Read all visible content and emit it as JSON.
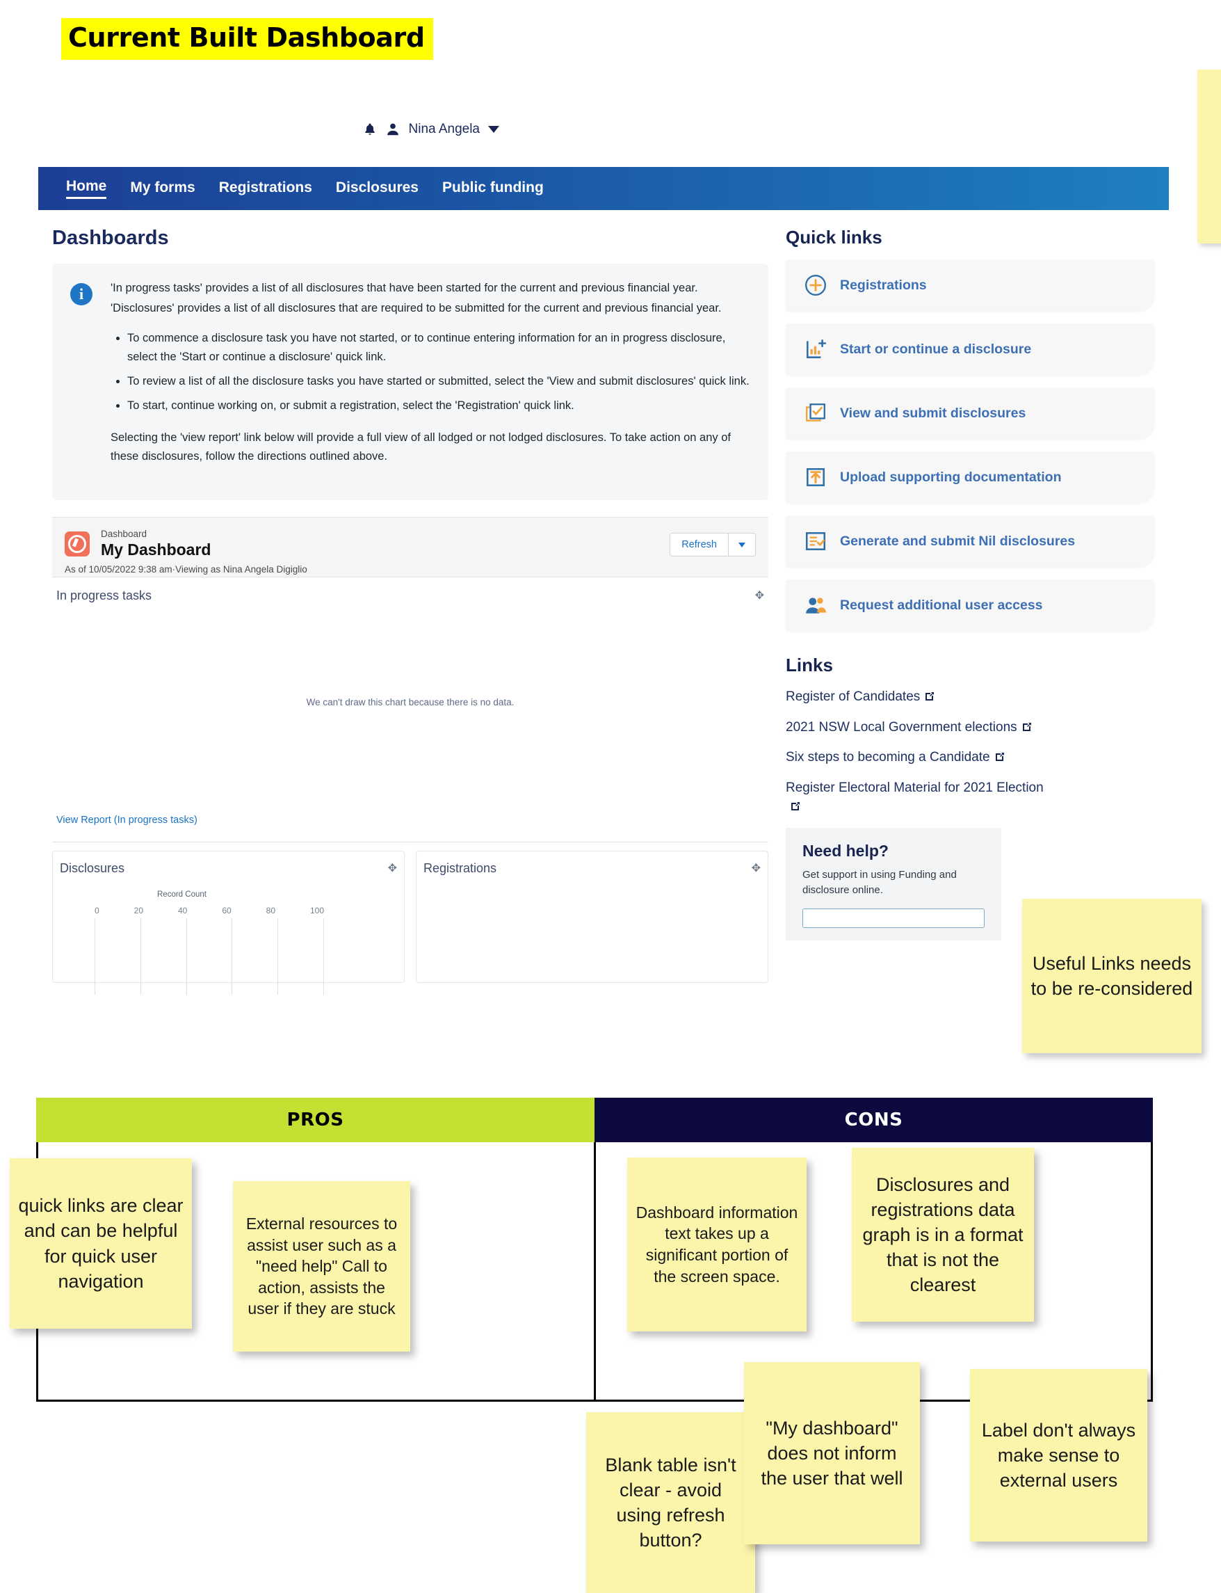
{
  "slide": {
    "title": "Current Built Dashboard"
  },
  "topbar": {
    "bell_icon": "bell-icon",
    "person_icon": "person-icon",
    "username": "Nina Angela",
    "caret_icon": "chevron-down-icon"
  },
  "nav": {
    "items": [
      {
        "label": "Home",
        "active": true
      },
      {
        "label": "My forms",
        "active": false
      },
      {
        "label": "Registrations",
        "active": false
      },
      {
        "label": "Disclosures",
        "active": false
      },
      {
        "label": "Public funding",
        "active": false
      }
    ]
  },
  "main": {
    "heading": "Dashboards",
    "info": {
      "icon": "info-icon",
      "para1": "'In progress tasks' provides a list of all disclosures that have been started for the current and previous financial year.",
      "para2": "'Disclosures' provides a list of all disclosures that are required to be submitted for the current and previous financial year.",
      "bullets": [
        "To commence a disclosure task you have not started, or to continue entering information for an in progress disclosure, select the 'Start or continue a disclosure' quick link.",
        "To review a list of all the disclosure tasks you have started or submitted, select the 'View and submit disclosures' quick link.",
        "To start, continue working on, or submit a registration, select the 'Registration' quick link."
      ],
      "tail": "Selecting the 'view report' link below will provide a full view of all lodged or not lodged disclosures. To take action on any of these disclosures, follow the directions outlined above."
    },
    "dashboard_card": {
      "logo_icon": "salesforce-dashboard-icon",
      "kind": "Dashboard",
      "name": "My Dashboard",
      "as_of": "As of 10/05/2022 9:38 am·Viewing as Nina Angela Digiglio",
      "refresh_label": "Refresh",
      "refresh_caret_icon": "chevron-down-icon"
    },
    "in_progress": {
      "title": "In progress tasks",
      "expand_icon": "expand-icon",
      "no_data": "We can't draw this chart because there is no data.",
      "view_report": "View Report (In progress tasks)"
    }
  },
  "chart_data": [
    {
      "type": "bar",
      "title": "Disclosures",
      "xlabel": "Record Count",
      "ylabel": "",
      "categories": [],
      "values": [],
      "xticks": [
        "0",
        "20",
        "40",
        "60",
        "80",
        "100"
      ],
      "xlim": [
        0,
        100
      ],
      "grid": true,
      "legend": "none",
      "expand_icon": "expand-icon",
      "note": "empty chart - axis only, no bars rendered"
    },
    {
      "type": "bar",
      "title": "Registrations",
      "xlabel": "",
      "ylabel": "",
      "categories": [],
      "values": [],
      "xticks": [],
      "grid": false,
      "legend": "none",
      "expand_icon": "expand-icon",
      "note": "empty chart - no data rendered"
    }
  ],
  "quick_links": {
    "heading": "Quick links",
    "items": [
      {
        "label": "Registrations",
        "icon": "plus-circle-icon"
      },
      {
        "label": "Start or continue a disclosure",
        "icon": "chart-add-icon"
      },
      {
        "label": "View and submit disclosures",
        "icon": "checked-box-icon"
      },
      {
        "label": "Upload supporting documentation",
        "icon": "upload-box-icon"
      },
      {
        "label": "Generate and submit Nil disclosures",
        "icon": "checklist-icon"
      },
      {
        "label": "Request additional user access",
        "icon": "users-icon"
      }
    ]
  },
  "links": {
    "heading": "Links",
    "items": [
      {
        "label": "Register of Candidates",
        "icon": "external-link-icon"
      },
      {
        "label": "2021 NSW Local Government elections",
        "icon": "external-link-icon"
      },
      {
        "label": "Six steps to becoming a Candidate",
        "icon": "external-link-icon"
      },
      {
        "label": "Register Electoral Material for 2021 Election",
        "icon": "external-link-icon"
      }
    ]
  },
  "need_help": {
    "heading": "Need help?",
    "body": "Get support in using Funding and disclosure online."
  },
  "annotations": {
    "useful_links": "Useful Links needs to be re-considered"
  },
  "pros_cons": {
    "pros_label": "PROS",
    "cons_label": "CONS",
    "pros": [
      "quick links are clear and can be helpful for quick user navigation",
      "External resources to assist user such as a \"need help\" Call to action, assists the user if they are stuck"
    ],
    "cons": [
      "Dashboard information text takes up a significant portion of the screen space.",
      "Disclosures and registrations data graph is in a format that is not the clearest",
      "Blank table isn't clear - avoid using refresh button?",
      "\"My dashboard\" does not inform the user that well",
      "Label don't always make sense to external users"
    ]
  },
  "colors": {
    "highlight_yellow": "#ffff00",
    "sticky_yellow": "#fbf5ac",
    "nav_blue": "#1c3f94",
    "pros_green": "#c3e033",
    "cons_navy": "#0c0a3e",
    "link_blue": "#3d6fb4",
    "heading_navy": "#16244f"
  }
}
